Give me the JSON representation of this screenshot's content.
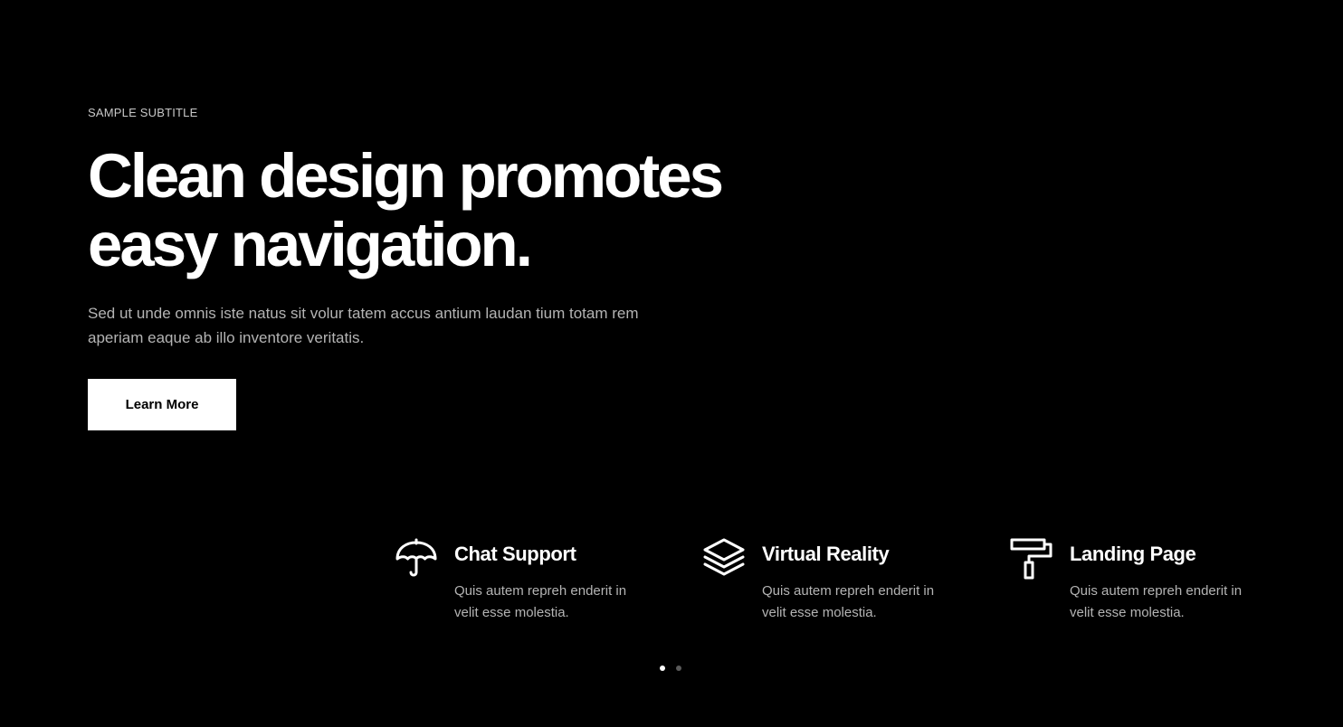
{
  "hero": {
    "subtitle": "SAMPLE SUBTITLE",
    "title_line1": "Clean design promotes",
    "title_line2": "easy navigation.",
    "description": "Sed ut unde omnis iste natus sit volur tatem accus antium laudan tium totam rem aperiam eaque ab illo inventore veritatis.",
    "button_label": "Learn More"
  },
  "features": [
    {
      "icon": "umbrella-icon",
      "title": "Chat Support",
      "description": "Quis autem repreh enderit in velit esse molestia."
    },
    {
      "icon": "layers-icon",
      "title": "Virtual Reality",
      "description": "Quis autem repreh enderit in velit esse molestia."
    },
    {
      "icon": "paint-roller-icon",
      "title": "Landing Page",
      "description": "Quis autem repreh enderit in velit esse molestia."
    }
  ],
  "pagination": {
    "active_index": 0,
    "count": 2
  },
  "colors": {
    "background": "#000000",
    "text_primary": "#ffffff",
    "text_muted": "#b4b4b4",
    "button_bg": "#ffffff",
    "button_text": "#000000"
  }
}
